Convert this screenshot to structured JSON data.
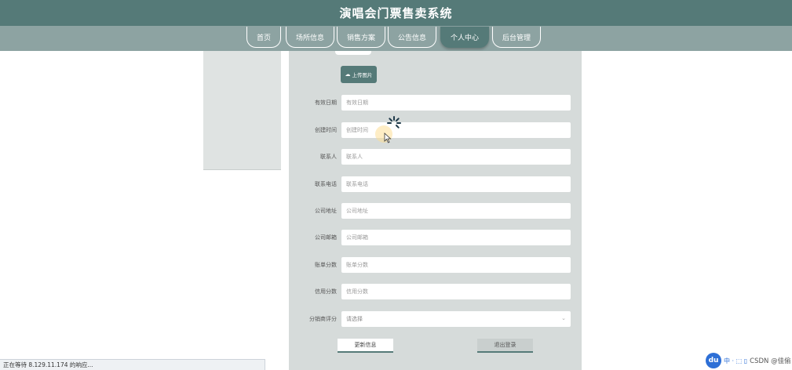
{
  "header": {
    "title": "演唱会门票售卖系统"
  },
  "nav": {
    "items": [
      {
        "label": "首页",
        "active": false
      },
      {
        "label": "场所信息",
        "active": false
      },
      {
        "label": "销售方案",
        "active": false
      },
      {
        "label": "公告信息",
        "active": false
      },
      {
        "label": "个人中心",
        "active": true
      },
      {
        "label": "后台管理",
        "active": false
      }
    ]
  },
  "form": {
    "upload_label": "上传图片",
    "upload_icon": "cloud-upload-icon",
    "fields": [
      {
        "label": "有效日期",
        "placeholder": "有效日期",
        "value": ""
      },
      {
        "label": "创建时间",
        "placeholder": "创建时间",
        "value": ""
      },
      {
        "label": "联系人",
        "placeholder": "联系人",
        "value": ""
      },
      {
        "label": "联系电话",
        "placeholder": "联系电话",
        "value": ""
      },
      {
        "label": "公司地址",
        "placeholder": "公司地址",
        "value": ""
      },
      {
        "label": "公司邮箱",
        "placeholder": "公司邮箱",
        "value": ""
      },
      {
        "label": "账单分数",
        "placeholder": "账单分数",
        "value": ""
      },
      {
        "label": "信用分数",
        "placeholder": "信用分数",
        "value": ""
      }
    ],
    "rating": {
      "label": "分销商评分",
      "placeholder": "请选择"
    },
    "update_label": "更新信息",
    "logout_label": "退出登录"
  },
  "status_bar": {
    "text": "正在等待 8.129.11.174 的响应..."
  },
  "watermark": {
    "logo_text": "du",
    "tools": "中 · ⬚ ▯",
    "text": "CSDN @佳偷"
  },
  "colors": {
    "header": "#557a78",
    "nav": "#8da3a2",
    "panel": "#d6dbda",
    "accent": "#557a78"
  }
}
